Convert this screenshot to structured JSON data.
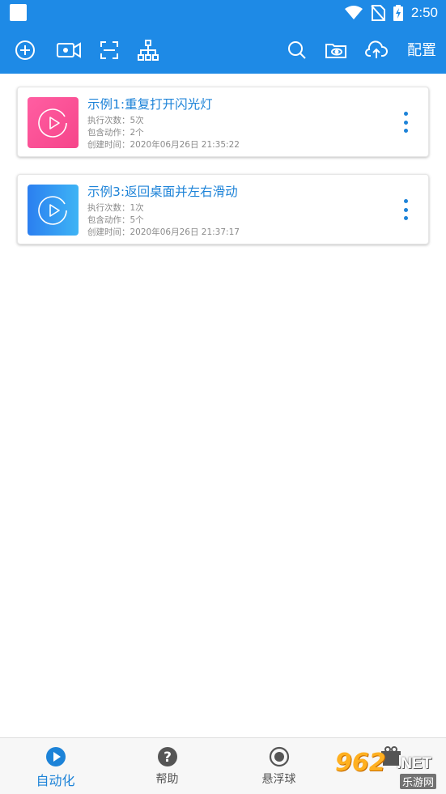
{
  "status_bar": {
    "time": "2:50"
  },
  "toolbar": {
    "icons": [
      "add-circle-icon",
      "record-video-icon",
      "scan-frame-icon",
      "hierarchy-icon",
      "search-icon",
      "folder-eye-icon",
      "cloud-upload-icon"
    ],
    "config_label": "配置"
  },
  "scripts": [
    {
      "title": "示例1:重复打开闪光灯",
      "exec_count": "执行次数：5次",
      "actions": "包含动作：2个",
      "created": "创建时间：2020年06月26日 21:35:22",
      "thumb_color": "#f6458a"
    },
    {
      "title": "示例3:返回桌面并左右滑动",
      "exec_count": "执行次数：1次",
      "actions": "包含动作：5个",
      "created": "创建时间：2020年06月26日 21:37:17",
      "thumb_color": "#2b7ff0"
    }
  ],
  "bottom_nav": {
    "items": [
      {
        "label": "自动化",
        "icon": "play-circle-icon",
        "active": true
      },
      {
        "label": "帮助",
        "icon": "help-circle-icon",
        "active": false
      },
      {
        "label": "悬浮球",
        "icon": "radio-circle-icon",
        "active": false
      },
      {
        "label": "",
        "icon": "gift-icon",
        "active": false
      }
    ]
  },
  "watermark": {
    "top": "962",
    "net": ".NET",
    "bottom": "乐游网"
  },
  "colors": {
    "primary": "#1e8ae6",
    "accent_text": "#1d83d8"
  }
}
